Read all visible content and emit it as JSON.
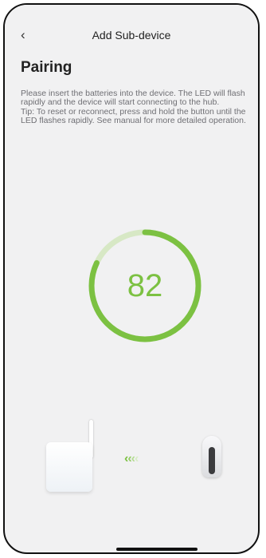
{
  "header": {
    "back_icon": "chevron-left-icon",
    "title": "Add Sub-device"
  },
  "pairing": {
    "title": "Pairing",
    "description": "Please insert the batteries into the device. The LED will  flash rapidly and the device will start connecting to the hub.",
    "tip": "Tip: To reset or reconnect, press and hold the button until the LED flashes rapidly. See manual for more detailed operation.",
    "progress": 82
  },
  "colors": {
    "accent": "#7cc142",
    "accent_light": "#d7e8c5",
    "background": "#f1f1f2"
  },
  "illustration": {
    "hub_icon": "hub-device-icon",
    "arrows_icon": "pairing-arrows-icon",
    "sensor_icon": "sensor-device-icon"
  }
}
